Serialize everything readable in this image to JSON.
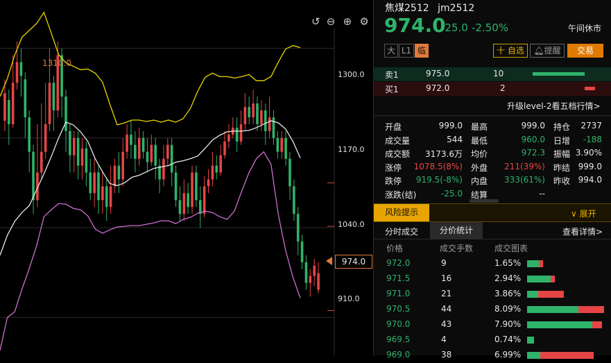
{
  "chart_toolbar": {
    "undo_icon": "undo-icon",
    "zoom_out_icon": "zoom-out-icon",
    "zoom_in_icon": "zoom-in-icon",
    "settings_icon": "gear-icon"
  },
  "chart_data": {
    "type": "candlestick",
    "y_ticks": [
      "1300.0",
      "1170.0",
      "1040.0",
      "910.0"
    ],
    "y_tick_values": [
      1300,
      1170,
      1040,
      910
    ],
    "high_marker": "1310.0",
    "last_price_tag": "974.0",
    "ylim": [
      855,
      1370
    ],
    "colors": {
      "up": "#e64545",
      "down": "#2fb36b",
      "upper_band": "#e8d800",
      "middle_band": "#e8e8e8",
      "lower_band": "#d070d0"
    },
    "upper_band": [
      1230,
      1256,
      1290,
      1316,
      1326,
      1336,
      1352,
      1322,
      1291,
      1279,
      1274,
      1269,
      1270,
      1264,
      1251,
      1219,
      1189,
      1192,
      1196,
      1196,
      1194,
      1196,
      1193,
      1196,
      1193,
      1198,
      1213,
      1238,
      1258,
      1264,
      1259,
      1259,
      1257,
      1259,
      1262,
      1253,
      1253,
      1259,
      1280,
      1299,
      1304,
      1301
    ],
    "middle_band": [
      1000,
      1029,
      1049,
      1062,
      1072,
      1095,
      1118,
      1143,
      1170,
      1193,
      1189,
      1179,
      1165,
      1140,
      1121,
      1104,
      1101,
      1105,
      1113,
      1116,
      1121,
      1126,
      1128,
      1130,
      1135,
      1137,
      1140,
      1144,
      1155,
      1167,
      1174,
      1179,
      1180,
      1180,
      1181,
      1185,
      1190,
      1195,
      1192,
      1183,
      1165,
      1141
    ],
    "lower_band": [
      862,
      910,
      918,
      951,
      981,
      1014,
      1056,
      1066,
      1075,
      1074,
      1068,
      1066,
      1057,
      1038,
      1032,
      1037,
      1041,
      1042,
      1043,
      1043,
      1045,
      1047,
      1050,
      1050,
      1046,
      1052,
      1055,
      1061,
      1064,
      1062,
      1056,
      1052,
      1064,
      1093,
      1120,
      1140,
      1150,
      1132,
      1059,
      1007,
      968,
      938
    ],
    "candles": [
      {
        "o": 1195,
        "c": 1235,
        "h": 1255,
        "l": 1180
      },
      {
        "o": 1225,
        "c": 1190,
        "h": 1240,
        "l": 1160
      },
      {
        "o": 1190,
        "c": 1250,
        "h": 1290,
        "l": 1185
      },
      {
        "o": 1250,
        "c": 1280,
        "h": 1310,
        "l": 1240
      },
      {
        "o": 1280,
        "c": 1260,
        "h": 1300,
        "l": 1230
      },
      {
        "o": 1255,
        "c": 1200,
        "h": 1265,
        "l": 1170
      },
      {
        "o": 1200,
        "c": 1150,
        "h": 1210,
        "l": 1120
      },
      {
        "o": 1150,
        "c": 1080,
        "h": 1160,
        "l": 1060
      },
      {
        "o": 1080,
        "c": 1120,
        "h": 1190,
        "l": 1070
      },
      {
        "o": 1120,
        "c": 1150,
        "h": 1220,
        "l": 1110
      },
      {
        "o": 1150,
        "c": 1190,
        "h": 1250,
        "l": 1140
      },
      {
        "o": 1190,
        "c": 1250,
        "h": 1300,
        "l": 1180
      },
      {
        "o": 1250,
        "c": 1210,
        "h": 1260,
        "l": 1180
      },
      {
        "o": 1210,
        "c": 1290,
        "h": 1310,
        "l": 1200
      },
      {
        "o": 1290,
        "c": 1230,
        "h": 1300,
        "l": 1200
      },
      {
        "o": 1230,
        "c": 1180,
        "h": 1240,
        "l": 1150
      },
      {
        "o": 1180,
        "c": 1145,
        "h": 1190,
        "l": 1120
      },
      {
        "o": 1145,
        "c": 1170,
        "h": 1180,
        "l": 1120
      },
      {
        "o": 1170,
        "c": 1130,
        "h": 1180,
        "l": 1110
      },
      {
        "o": 1130,
        "c": 1155,
        "h": 1170,
        "l": 1110
      },
      {
        "o": 1155,
        "c": 1120,
        "h": 1165,
        "l": 1100
      },
      {
        "o": 1120,
        "c": 1090,
        "h": 1140,
        "l": 1080
      },
      {
        "o": 1090,
        "c": 1120,
        "h": 1140,
        "l": 1070
      },
      {
        "o": 1120,
        "c": 1080,
        "h": 1130,
        "l": 1060
      },
      {
        "o": 1080,
        "c": 1100,
        "h": 1120,
        "l": 1060
      },
      {
        "o": 1100,
        "c": 1070,
        "h": 1110,
        "l": 1050
      },
      {
        "o": 1070,
        "c": 1100,
        "h": 1130,
        "l": 1060
      },
      {
        "o": 1100,
        "c": 1130,
        "h": 1140,
        "l": 1090
      },
      {
        "o": 1130,
        "c": 1110,
        "h": 1150,
        "l": 1090
      },
      {
        "o": 1110,
        "c": 1150,
        "h": 1170,
        "l": 1100
      },
      {
        "o": 1150,
        "c": 1175,
        "h": 1190,
        "l": 1140
      },
      {
        "o": 1175,
        "c": 1160,
        "h": 1195,
        "l": 1140
      },
      {
        "o": 1160,
        "c": 1140,
        "h": 1180,
        "l": 1120
      },
      {
        "o": 1140,
        "c": 1170,
        "h": 1185,
        "l": 1130
      },
      {
        "o": 1170,
        "c": 1150,
        "h": 1180,
        "l": 1140
      },
      {
        "o": 1150,
        "c": 1135,
        "h": 1170,
        "l": 1120
      },
      {
        "o": 1135,
        "c": 1160,
        "h": 1175,
        "l": 1130
      },
      {
        "o": 1160,
        "c": 1130,
        "h": 1170,
        "l": 1110
      },
      {
        "o": 1130,
        "c": 1110,
        "h": 1140,
        "l": 1090
      },
      {
        "o": 1110,
        "c": 1140,
        "h": 1160,
        "l": 1100
      },
      {
        "o": 1140,
        "c": 1160,
        "h": 1170,
        "l": 1130
      },
      {
        "o": 1160,
        "c": 1120,
        "h": 1170,
        "l": 1100
      },
      {
        "o": 1120,
        "c": 1080,
        "h": 1130,
        "l": 1070
      },
      {
        "o": 1080,
        "c": 1060,
        "h": 1100,
        "l": 1050
      },
      {
        "o": 1060,
        "c": 1090,
        "h": 1110,
        "l": 1050
      },
      {
        "o": 1090,
        "c": 1070,
        "h": 1105,
        "l": 1060
      },
      {
        "o": 1070,
        "c": 1120,
        "h": 1130,
        "l": 1060
      },
      {
        "o": 1120,
        "c": 1080,
        "h": 1130,
        "l": 1070
      },
      {
        "o": 1080,
        "c": 1060,
        "h": 1100,
        "l": 1040
      },
      {
        "o": 1060,
        "c": 1100,
        "h": 1115,
        "l": 1055
      },
      {
        "o": 1100,
        "c": 1110,
        "h": 1125,
        "l": 1090
      },
      {
        "o": 1110,
        "c": 1130,
        "h": 1150,
        "l": 1100
      },
      {
        "o": 1130,
        "c": 1120,
        "h": 1145,
        "l": 1110
      },
      {
        "o": 1120,
        "c": 1145,
        "h": 1160,
        "l": 1115
      },
      {
        "o": 1145,
        "c": 1165,
        "h": 1180,
        "l": 1140
      },
      {
        "o": 1165,
        "c": 1175,
        "h": 1190,
        "l": 1155
      },
      {
        "o": 1175,
        "c": 1185,
        "h": 1200,
        "l": 1170
      },
      {
        "o": 1185,
        "c": 1165,
        "h": 1200,
        "l": 1150
      },
      {
        "o": 1165,
        "c": 1190,
        "h": 1210,
        "l": 1160
      },
      {
        "o": 1190,
        "c": 1215,
        "h": 1235,
        "l": 1180
      },
      {
        "o": 1215,
        "c": 1200,
        "h": 1230,
        "l": 1190
      },
      {
        "o": 1200,
        "c": 1220,
        "h": 1240,
        "l": 1190
      },
      {
        "o": 1220,
        "c": 1190,
        "h": 1230,
        "l": 1180
      },
      {
        "o": 1190,
        "c": 1210,
        "h": 1225,
        "l": 1180
      },
      {
        "o": 1210,
        "c": 1180,
        "h": 1220,
        "l": 1160
      },
      {
        "o": 1180,
        "c": 1200,
        "h": 1230,
        "l": 1170
      },
      {
        "o": 1200,
        "c": 1170,
        "h": 1210,
        "l": 1160
      },
      {
        "o": 1170,
        "c": 1150,
        "h": 1180,
        "l": 1140
      },
      {
        "o": 1150,
        "c": 1170,
        "h": 1180,
        "l": 1140
      },
      {
        "o": 1170,
        "c": 1140,
        "h": 1180,
        "l": 1130
      },
      {
        "o": 1140,
        "c": 1100,
        "h": 1150,
        "l": 1080
      },
      {
        "o": 1100,
        "c": 1060,
        "h": 1110,
        "l": 1050
      },
      {
        "o": 1060,
        "c": 1020,
        "h": 1070,
        "l": 1000
      },
      {
        "o": 1020,
        "c": 990,
        "h": 1030,
        "l": 980
      },
      {
        "o": 990,
        "c": 960,
        "h": 1000,
        "l": 950
      },
      {
        "o": 960,
        "c": 970,
        "h": 980,
        "l": 940
      },
      {
        "o": 970,
        "c": 985,
        "h": 995,
        "l": 955
      },
      {
        "o": 950,
        "c": 974,
        "h": 990,
        "l": 945
      }
    ]
  },
  "quote": {
    "name": "焦煤2512",
    "code": "jm2512",
    "price": "974.0",
    "change": "-25.0",
    "change_pct": "-2.50%",
    "session_status": "午间休市",
    "tags": [
      "大",
      "L1",
      "临"
    ],
    "btn_watchlist": "十 自选",
    "btn_alert": "提醒",
    "btn_trade": "交易",
    "sell1_label": "卖1",
    "sell1_price": "975.0",
    "sell1_vol": "10",
    "sell1_fill": 0.83,
    "buy1_label": "买1",
    "buy1_price": "972.0",
    "buy1_vol": "2",
    "buy1_fill": 0.17,
    "upgrade_link": "升级level-2看五档行情>"
  },
  "stats": {
    "col1": [
      {
        "label": "开盘",
        "value": "999.0",
        "color": "white"
      },
      {
        "label": "成交量",
        "value": "544",
        "color": "white"
      },
      {
        "label": "成交额",
        "value": "3173.6万",
        "color": "white"
      },
      {
        "label": "涨停",
        "value": "1078.5(8%)",
        "color": "up"
      },
      {
        "label": "跌停",
        "value": "919.5(-8%)",
        "color": "down"
      },
      {
        "label": "涨跌(结)",
        "value": "-25.0",
        "color": "down"
      }
    ],
    "col2": [
      {
        "label": "最高",
        "value": "999.0",
        "color": "white"
      },
      {
        "label": "最低",
        "value": "960.0",
        "color": "down"
      },
      {
        "label": "均价",
        "value": "972.3",
        "color": "down"
      },
      {
        "label": "外盘",
        "value": "211(39%)",
        "color": "up"
      },
      {
        "label": "内盘",
        "value": "333(61%)",
        "color": "down"
      },
      {
        "label": "结算",
        "value": "--",
        "color": "white"
      }
    ],
    "col3": [
      {
        "label": "持仓",
        "value": "2737",
        "color": "white"
      },
      {
        "label": "日增",
        "value": "-188",
        "color": "down"
      },
      {
        "label": "振幅",
        "value": "3.90%",
        "color": "white"
      },
      {
        "label": "昨结",
        "value": "999.0",
        "color": "white"
      },
      {
        "label": "昨收",
        "value": "994.0",
        "color": "white"
      }
    ]
  },
  "risk": {
    "label": "风险提示",
    "expand": "展开"
  },
  "tabs": {
    "tab1": "分时成交",
    "tab2": "分价统计",
    "detail_link": "查看详情>"
  },
  "table": {
    "headers": [
      "价格",
      "成交手数",
      "成交图表"
    ],
    "rows": [
      {
        "price": "972.0",
        "vol": "9",
        "pct": "1.65%",
        "buy": 0.75,
        "sell": 0.25
      },
      {
        "price": "971.5",
        "vol": "16",
        "pct": "2.94%",
        "buy": 0.85,
        "sell": 0.15
      },
      {
        "price": "971.0",
        "vol": "21",
        "pct": "3.86%",
        "buy": 0.3,
        "sell": 0.7
      },
      {
        "price": "970.5",
        "vol": "44",
        "pct": "8.09%",
        "buy": 0.67,
        "sell": 0.33
      },
      {
        "price": "970.0",
        "vol": "43",
        "pct": "7.90%",
        "buy": 0.87,
        "sell": 0.13
      },
      {
        "price": "969.5",
        "vol": "4",
        "pct": "0.74%",
        "buy": 1.0,
        "sell": 0.0
      },
      {
        "price": "969.0",
        "vol": "38",
        "pct": "6.99%",
        "buy": 0.2,
        "sell": 0.8
      }
    ],
    "max_pct": 8.09
  }
}
